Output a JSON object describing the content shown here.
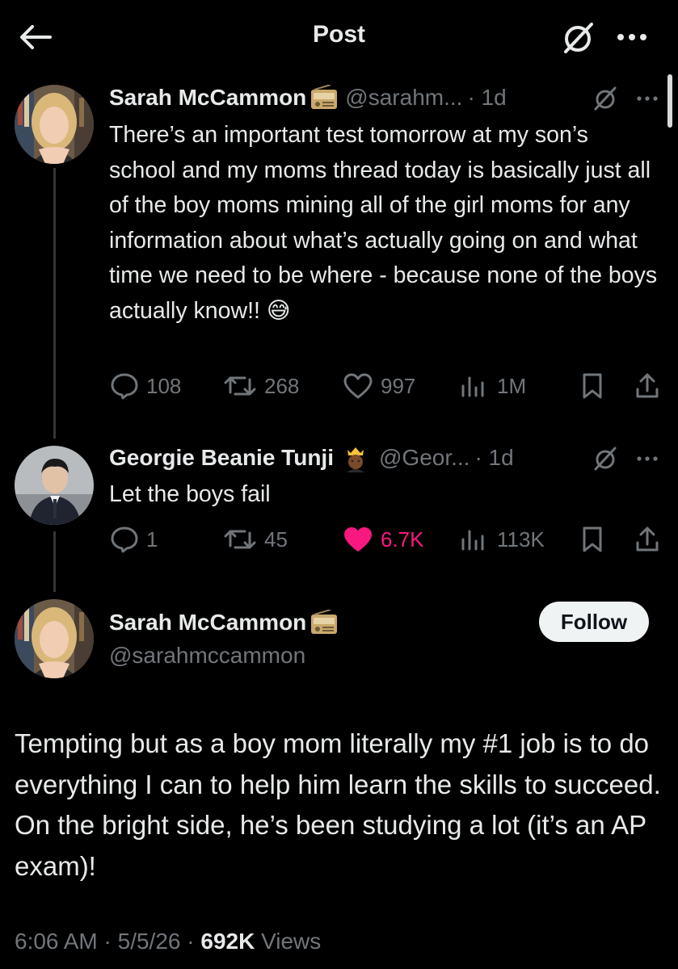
{
  "header": {
    "title": "Post"
  },
  "thread": [
    {
      "name": "Sarah McCammon",
      "handle": "@sarahm...",
      "time": "· 1d",
      "text": "There’s an important test tomorrow at my son’s school and my moms thread today is basically just all of the boy moms mining all of the girl moms for any information about what’s actually going on and what time we need to be where - because none of the boys actually know!!",
      "emoji": "😅",
      "stats": {
        "replies": "108",
        "reposts": "268",
        "likes": "997",
        "views": "1M"
      }
    },
    {
      "name": "Georgie Beanie Tunji",
      "handle": "@Geor...",
      "time": "· 1d",
      "text": "Let the boys fail",
      "stats": {
        "replies": "1",
        "reposts": "45",
        "likes": "6.7K",
        "views": "113K"
      }
    }
  ],
  "main_post": {
    "name": "Sarah McCammon",
    "handle": "@sarahmccammon",
    "follow_label": "Follow",
    "text": "Tempting but as a boy mom literally my #1 job is to do everything I can to help him learn the skills to succeed. On the bright side, he’s been studying a lot (it’s an AP exam)!",
    "time": "6:06 AM",
    "date": "5/5/26",
    "views": "692K",
    "views_label": "Views"
  },
  "colors": {
    "background": "#000000",
    "text": "#e7e9ea",
    "muted": "#71767b",
    "like": "#f91880",
    "follow_bg": "#eff3f4"
  },
  "icons": [
    "back-arrow-icon",
    "grok-icon",
    "more-icon",
    "radio-icon",
    "crown-emoji-icon",
    "reply-icon",
    "repost-icon",
    "like-icon",
    "views-icon",
    "bookmark-icon",
    "share-icon"
  ]
}
